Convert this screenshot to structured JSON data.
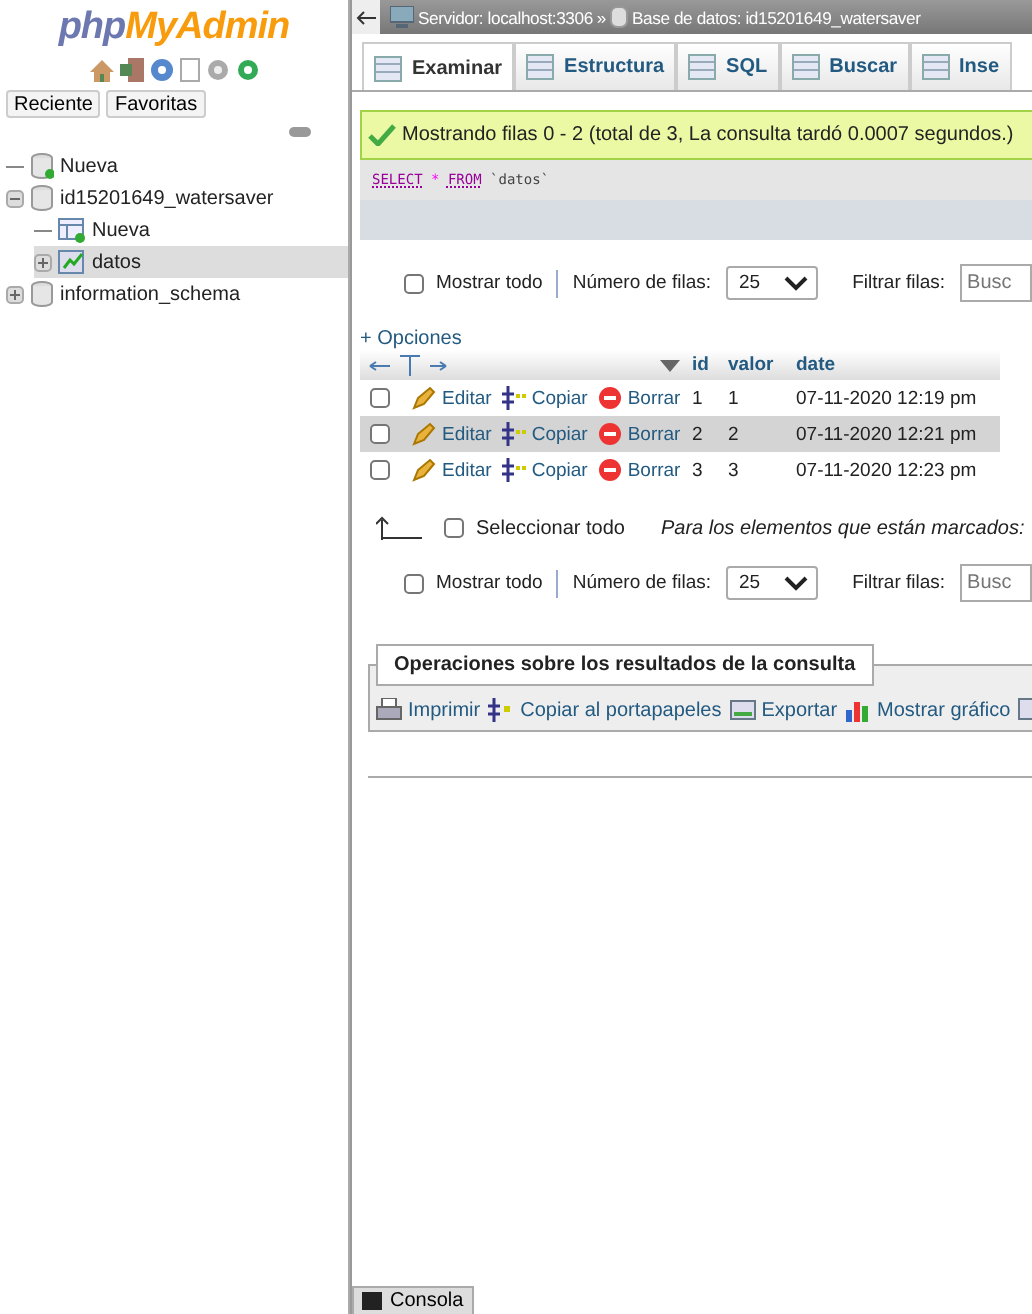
{
  "logo": {
    "part1": "php",
    "part2": "MyAdmin"
  },
  "sidebar": {
    "buttons": [
      "Reciente",
      "Favoritas"
    ],
    "tree": [
      {
        "label": "Nueva",
        "kind": "new",
        "selected": false
      },
      {
        "label": "id15201649_watersaver",
        "kind": "db",
        "expanded": true,
        "selected": false,
        "children": [
          {
            "label": "Nueva",
            "kind": "newtable",
            "selected": false
          },
          {
            "label": "datos",
            "kind": "table",
            "expanded": false,
            "selected": true
          }
        ]
      },
      {
        "label": "information_schema",
        "kind": "db",
        "expanded": false,
        "selected": false
      }
    ]
  },
  "breadcrumb": [
    "Servidor: localhost:3306",
    "»",
    "Base de datos: id15201649_watersaver"
  ],
  "tabs": [
    {
      "label": "Examinar",
      "selected": true
    },
    {
      "label": "Estructura",
      "selected": false
    },
    {
      "label": "SQL",
      "selected": false
    },
    {
      "label": "Buscar",
      "selected": false
    },
    {
      "label": "Inse",
      "selected": false
    }
  ],
  "message": "Mostrando filas 0 - 2 (total de 3, La consulta tardó 0.0007 segundos.)",
  "sql": [
    {
      "text": "SELECT",
      "kind": "keyword"
    },
    {
      "text": "*",
      "kind": "operator"
    },
    {
      "text": "FROM",
      "kind": "keyword"
    },
    {
      "text": "`datos`",
      "kind": "name"
    }
  ],
  "navigation": [
    {
      "show_all": "Mostrar todo",
      "checked": false,
      "rows_label": "Número de filas:",
      "rows_value": "25",
      "filter_label": "Filtrar filas:",
      "filter_placeholder": "Busc"
    },
    {
      "show_all": "Mostrar todo",
      "checked": false,
      "rows_label": "Número de filas:",
      "rows_value": "25",
      "filter_label": "Filtrar filas:",
      "filter_placeholder": "Busc"
    }
  ],
  "options_link": "+ Opciones",
  "table": {
    "columns": [
      "id",
      "valor",
      "date"
    ],
    "rows": [
      {
        "checked": false,
        "selected": false,
        "actions": [
          "Editar",
          "Copiar",
          "Borrar"
        ],
        "cells": [
          "1",
          "1",
          "07-11-2020 12:19 pm"
        ]
      },
      {
        "checked": false,
        "selected": true,
        "actions": [
          "Editar",
          "Copiar",
          "Borrar"
        ],
        "cells": [
          "2",
          "2",
          "07-11-2020 12:21 pm"
        ]
      },
      {
        "checked": false,
        "selected": false,
        "actions": [
          "Editar",
          "Copiar",
          "Borrar"
        ],
        "cells": [
          "3",
          "3",
          "07-11-2020 12:23 pm"
        ]
      }
    ]
  },
  "bulk": {
    "select_all": "Seleccionar todo",
    "checked": false,
    "marked_label": "Para los elementos que están marcados:"
  },
  "operations": {
    "legend": "Operaciones sobre los resultados de la consulta",
    "items": [
      {
        "label": "Imprimir",
        "kind": "print"
      },
      {
        "label": "Copiar al portapapeles",
        "kind": "copy"
      },
      {
        "label": "Exportar",
        "kind": "export"
      },
      {
        "label": "Mostrar gráfico",
        "kind": "chart"
      }
    ]
  },
  "console": "Consola"
}
